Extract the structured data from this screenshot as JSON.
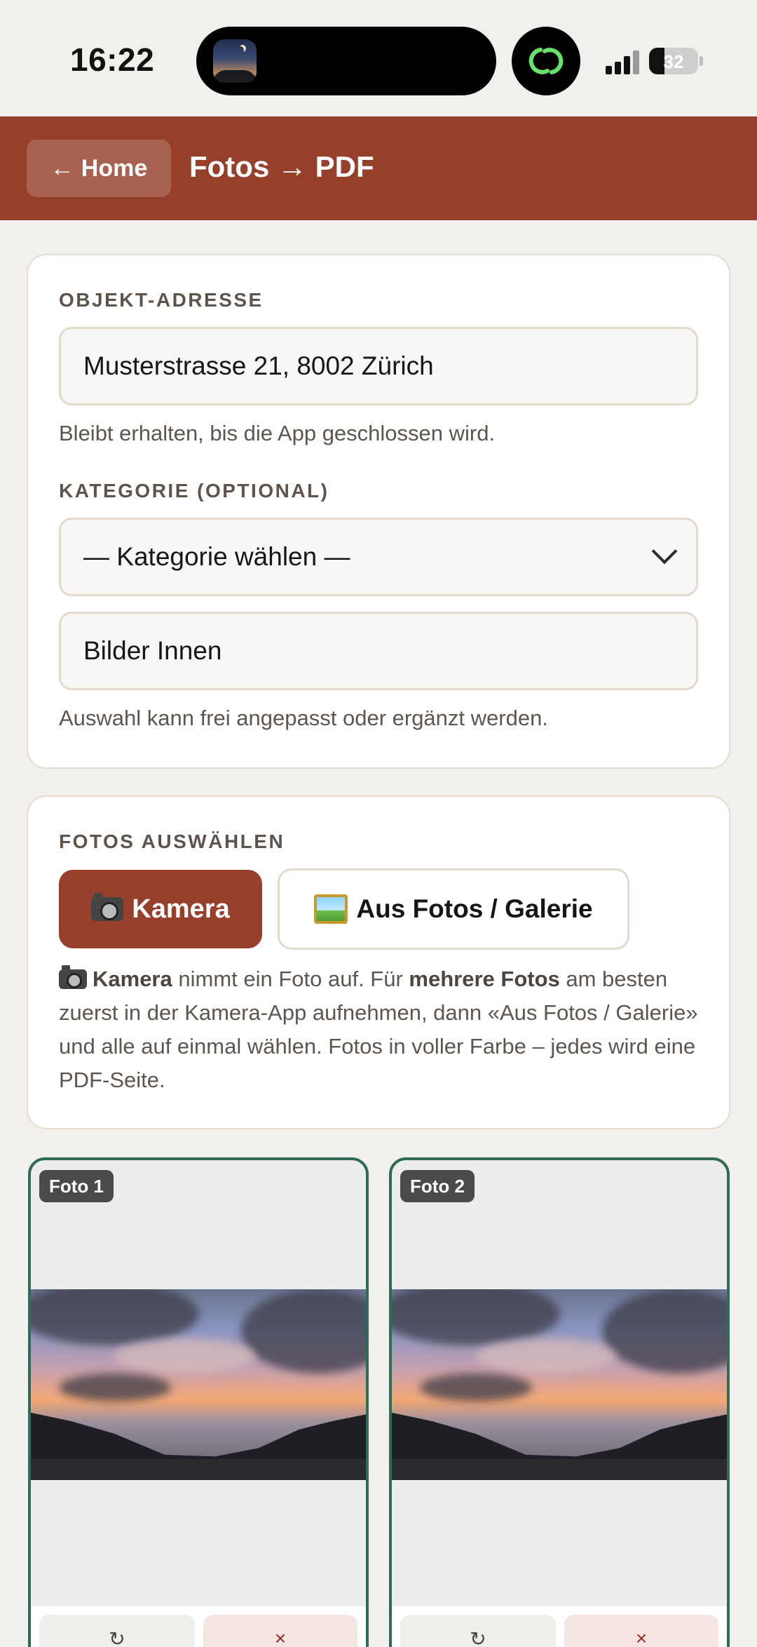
{
  "status_bar": {
    "time": "16:22",
    "battery": "32",
    "battery_level": 0.32
  },
  "header": {
    "home_label": "Home",
    "title": "Fotos → PDF"
  },
  "address": {
    "label": "OBJEKT-ADRESSE",
    "value": "Musterstrasse 21, 8002 Zürich",
    "helper": "Bleibt erhalten, bis die App geschlossen wird."
  },
  "category": {
    "label": "KATEGORIE (OPTIONAL)",
    "select_value": "— Kategorie wählen —",
    "custom_value": "Bilder Innen",
    "helper": "Auswahl kann frei angepasst oder ergänzt werden."
  },
  "photos": {
    "label": "FOTOS AUSWÄHLEN",
    "camera_button": "Kamera",
    "gallery_button": "Aus Fotos / Galerie",
    "desc_camera": "Kamera",
    "desc_part1": " nimmt ein Foto auf. Für ",
    "desc_multi": "mehrere Fotos",
    "desc_part2": " am besten zuerst in der Kamera-App aufnehmen, dann «Aus Fotos / Galerie» und alle auf einmal wählen. Fotos in voller Farbe – jedes wird eine PDF-Seite."
  },
  "thumbnails": [
    {
      "badge": "Foto 1"
    },
    {
      "badge": "Foto 2"
    }
  ],
  "colors": {
    "brand": "#963f2b",
    "selected_border": "#2e6b59",
    "background": "#f2f0ec"
  },
  "icons": {
    "back": "arrow-left-icon",
    "camera": "camera-icon",
    "gallery": "framed-picture-icon",
    "rotate": "rotate-icon",
    "remove": "close-icon",
    "chevron": "chevron-down-icon"
  }
}
